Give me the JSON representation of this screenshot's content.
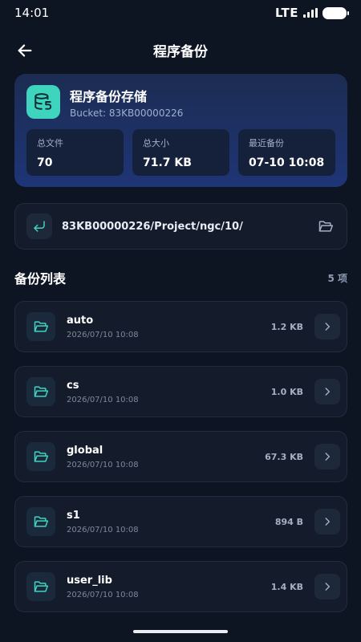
{
  "status_bar": {
    "time": "14:01",
    "network": "LTE"
  },
  "header": {
    "title": "程序备份"
  },
  "summary": {
    "title": "程序备份存储",
    "bucket": "Bucket: 83KB00000226",
    "stats": [
      {
        "label": "总文件",
        "value": "70"
      },
      {
        "label": "总大小",
        "value": "71.7 KB"
      },
      {
        "label": "最近备份",
        "value": "07-10 10:08"
      }
    ]
  },
  "path": {
    "value": "83KB00000226/Project/ngc/10/"
  },
  "list": {
    "title": "备份列表",
    "count": "5 项",
    "items": [
      {
        "name": "auto",
        "date": "2026/07/10 10:08",
        "size": "1.2 KB"
      },
      {
        "name": "cs",
        "date": "2026/07/10 10:08",
        "size": "1.0 KB"
      },
      {
        "name": "global",
        "date": "2026/07/10 10:08",
        "size": "67.3 KB"
      },
      {
        "name": "s1",
        "date": "2026/07/10 10:08",
        "size": "894 B"
      },
      {
        "name": "user_lib",
        "date": "2026/07/10 10:08",
        "size": "1.4 KB"
      }
    ]
  },
  "icons": {
    "back": "arrow-left-icon",
    "database": "database-restore-icon",
    "path_back": "return-icon",
    "path_folder": "folder-open-icon",
    "item_folder": "folder-open-icon",
    "item_chevron": "chevron-right-icon"
  },
  "colors": {
    "background": "#0d1422",
    "accent": "#3fd4bd",
    "card_gradient_top": "#1c2c52",
    "card_gradient_bottom": "#1e3576",
    "item_background": "#141c2c"
  }
}
